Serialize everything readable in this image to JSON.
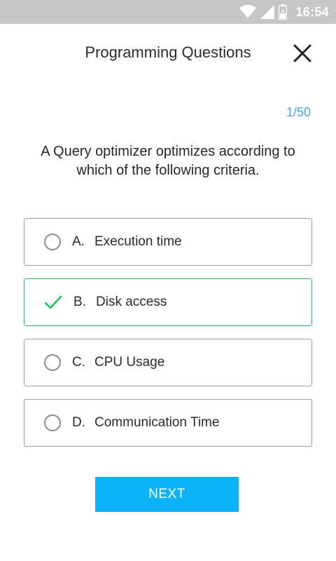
{
  "status_bar": {
    "time": "16:54",
    "icons": [
      "wifi-icon",
      "signal-icon",
      "battery-icon"
    ]
  },
  "header": {
    "title": "Programming Questions",
    "close_icon": "close-icon"
  },
  "quiz": {
    "counter": "1/50",
    "question": "A Query optimizer optimizes according to which of the following criteria."
  },
  "options": [
    {
      "letter": "A.",
      "text": "Execution time",
      "selected": false
    },
    {
      "letter": "B.",
      "text": "Disk access",
      "selected": true
    },
    {
      "letter": "C.",
      "text": "CPU Usage",
      "selected": false
    },
    {
      "letter": "D.",
      "text": "Communication Time",
      "selected": false
    }
  ],
  "actions": {
    "next_label": "NEXT"
  },
  "colors": {
    "accent": "#0bb3f8",
    "correct": "#1fbf55",
    "counter": "#4aa6e4",
    "status_bar": "#c6c6c6"
  }
}
